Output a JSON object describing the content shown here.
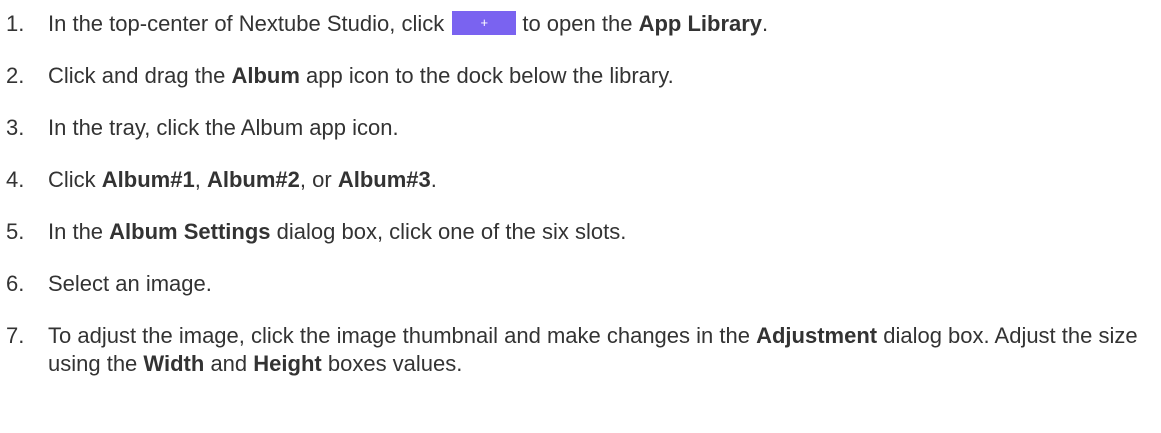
{
  "steps": [
    {
      "num": "1.",
      "a": "In the top-center of Nextube Studio, click",
      "button_glyph": "+",
      "b": "to open the",
      "c": "App Library",
      "d": "."
    },
    {
      "num": "2.",
      "a": "Click and drag the",
      "b": "Album",
      "c": "app icon to the dock below the library."
    },
    {
      "num": "3.",
      "a": "In the tray, click the Album app icon."
    },
    {
      "num": "4.",
      "a": "Click",
      "b": "Album#1",
      "c": ",",
      "d": "Album#2",
      "e": ", or",
      "f": "Album#3",
      "g": "."
    },
    {
      "num": "5.",
      "a": "In the",
      "b": "Album Settings",
      "c": "dialog box, click one of the six slots."
    },
    {
      "num": "6.",
      "a": "Select an image."
    },
    {
      "num": "7.",
      "a": "To adjust the image, click the image thumbnail and make changes in the",
      "b": "Adjustment",
      "c": "dialog box. Adjust the size using the",
      "d": "Width",
      "e": "and",
      "f": "Height",
      "g": "boxes values."
    }
  ],
  "colors": {
    "text": "#333333",
    "button_accent": "#7a63f0"
  }
}
